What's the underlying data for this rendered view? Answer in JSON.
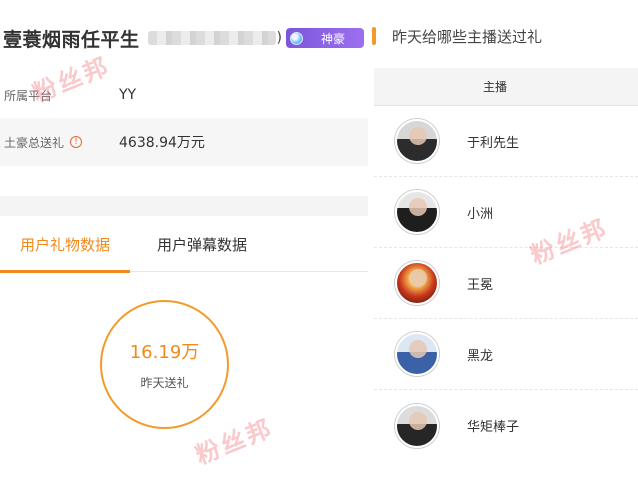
{
  "profile": {
    "username": "壹蓑烟雨任平生",
    "id_suffix": ")",
    "level_badge": "神豪"
  },
  "info": {
    "platform_label": "所属平台",
    "platform_value": "YY",
    "total_gift_label": "土豪总送礼",
    "total_gift_value": "4638.94万元",
    "help_icon_glyph": "!"
  },
  "tabs": [
    {
      "label": "用户礼物数据",
      "active": true
    },
    {
      "label": "用户弹幕数据",
      "active": false
    }
  ],
  "stat": {
    "value": "16.19万",
    "label": "昨天送礼"
  },
  "right_panel": {
    "title": "昨天给哪些主播送过礼",
    "column_header": "主播",
    "anchors": [
      {
        "name": "于利先生"
      },
      {
        "name": "小洲"
      },
      {
        "name": "王冕"
      },
      {
        "name": "黑龙"
      },
      {
        "name": "华矩棒子"
      }
    ]
  },
  "watermark": "粉丝邦",
  "colors": {
    "accent": "#f08a1c",
    "badge": "#8a63e6",
    "watermark": "#f0646e"
  }
}
